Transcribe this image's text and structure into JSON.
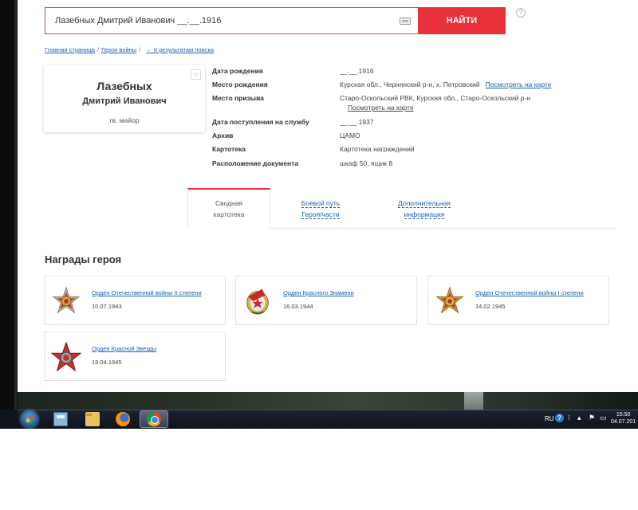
{
  "search": {
    "query": "Лазебных Дмитрий Иванович __.__.1916",
    "button_label": "НАЙТИ",
    "help": "?"
  },
  "breadcrumb": {
    "home": "Главная страница",
    "heroes": "Герои войны",
    "back": "← К результатам поиска",
    "separator": "/"
  },
  "hero": {
    "surname": "Лазебных",
    "names": "Дмитрий Иванович",
    "rank": "гв. майор",
    "star": "☆"
  },
  "info": [
    {
      "label": "Дата рождения",
      "value": "__.__.1916"
    },
    {
      "label": "Место рождения",
      "value": "Курская обл., Чернянский р-н, х. Петровский",
      "link": "Посмотреть на карте"
    },
    {
      "label": "Место призыва",
      "value": "Старо-Оскольский РВК, Курская обл., Старо-Оскольский р-н",
      "link": "Посмотреть на карте"
    },
    {
      "label": "Дата поступления на службу",
      "value": "__.__.1937"
    },
    {
      "label": "Архив",
      "value": "ЦАМО"
    },
    {
      "label": "Картотека",
      "value": "Картотека награждений"
    },
    {
      "label": "Расположение документа",
      "value": "шкаф 50, ящик 8"
    }
  ],
  "tabs": [
    {
      "line1": "Сводная",
      "line2": "картотека"
    },
    {
      "line1": "Боевой путь",
      "line2": "Героя/части"
    },
    {
      "line1": "Дополнительная",
      "line2": "информация"
    }
  ],
  "awards_title": "Награды героя",
  "awards": [
    {
      "name": "Орден Отечественной войны II степени",
      "date": "10.07.1943",
      "icon": "order-patriotic-war-2-icon"
    },
    {
      "name": "Орден Красного Знамени",
      "date": "16.03.1944",
      "icon": "order-red-banner-icon"
    },
    {
      "name": "Орден Отечественной войны I степени",
      "date": "14.02.1945",
      "icon": "order-patriotic-war-1-icon"
    },
    {
      "name": "Орден Красной Звезды",
      "date": "19.04.1945",
      "icon": "order-red-star-icon"
    }
  ],
  "taskbar": {
    "lang": "RU",
    "time": "15:50",
    "date": "04.07.201"
  },
  "colors": {
    "accent": "#e8313a",
    "link": "#1a5fb4"
  }
}
